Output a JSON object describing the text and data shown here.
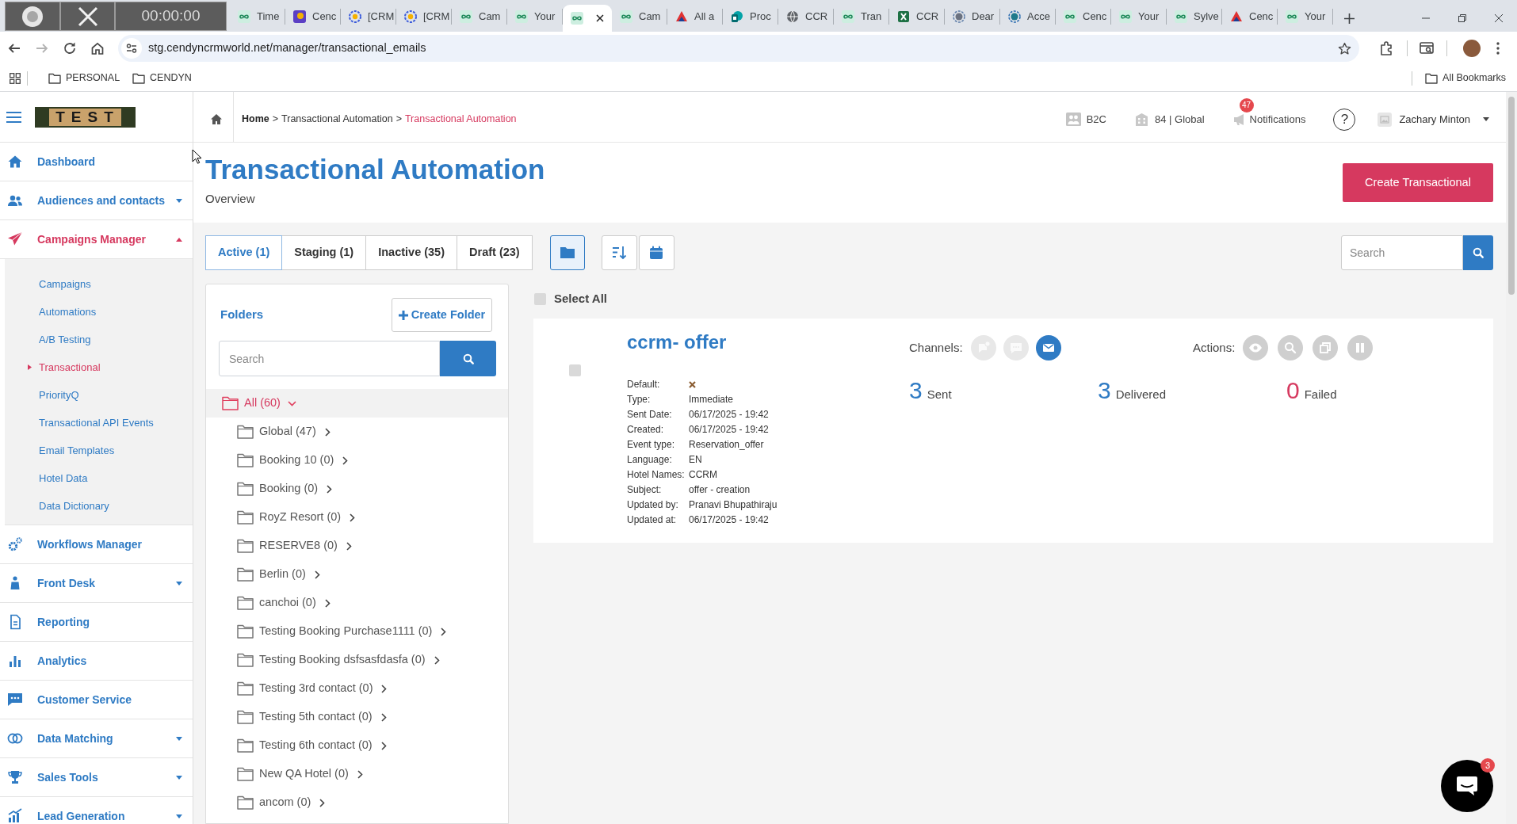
{
  "browser": {
    "recorder": {
      "timer": "00:00:00"
    },
    "tabs": [
      {
        "title": "Time",
        "selected": false
      },
      {
        "title": "Cenc",
        "selected": false
      },
      {
        "title": "[CRM",
        "selected": false
      },
      {
        "title": "[CRM",
        "selected": false
      },
      {
        "title": "Cam",
        "selected": false
      },
      {
        "title": "Your",
        "selected": false
      },
      {
        "selected": true
      },
      {
        "title": "Cam",
        "selected": false
      },
      {
        "title": "All a",
        "selected": false
      },
      {
        "title": "Proc",
        "selected": false
      },
      {
        "title": "CCR",
        "selected": false
      },
      {
        "title": "Tran",
        "selected": false
      },
      {
        "title": "CCR",
        "selected": false
      },
      {
        "title": "Dear",
        "selected": false
      },
      {
        "title": "Acce",
        "selected": false
      },
      {
        "title": "Cenc",
        "selected": false
      },
      {
        "title": "Your",
        "selected": false
      },
      {
        "title": "Sylve",
        "selected": false
      },
      {
        "title": "Cenc",
        "selected": false
      },
      {
        "title": "Your",
        "selected": false
      }
    ],
    "address": "stg.cendyncrmworld.net/manager/transactional_emails",
    "bookmarks": [
      {
        "label": "PERSONAL"
      },
      {
        "label": "CENDYN"
      }
    ],
    "all_bookmarks": {
      "label": "All Bookmarks"
    }
  },
  "sidebar": {
    "logo": "TEST",
    "items": [
      {
        "label": "Dashboard",
        "selected": false
      },
      {
        "label": "Audiences and contacts",
        "selected": false,
        "expanded": false
      },
      {
        "label": "Campaigns Manager",
        "selected": true,
        "expanded": true,
        "children": [
          {
            "label": "Campaigns",
            "selected": false
          },
          {
            "label": "Automations",
            "selected": false
          },
          {
            "label": "A/B Testing",
            "selected": false
          },
          {
            "label": "Transactional",
            "selected": true
          },
          {
            "label": "PriorityQ",
            "selected": false
          },
          {
            "label": "Transactional API Events",
            "selected": false
          },
          {
            "label": "Email Templates",
            "selected": false
          },
          {
            "label": "Hotel Data",
            "selected": false
          },
          {
            "label": "Data Dictionary",
            "selected": false
          }
        ]
      },
      {
        "label": "Workflows Manager",
        "selected": false
      },
      {
        "label": "Front Desk",
        "selected": false,
        "expanded": false
      },
      {
        "label": "Reporting",
        "selected": false
      },
      {
        "label": "Analytics",
        "selected": false
      },
      {
        "label": "Customer Service",
        "selected": false
      },
      {
        "label": "Data Matching",
        "selected": false,
        "expanded": false
      },
      {
        "label": "Sales Tools",
        "selected": false,
        "expanded": false
      },
      {
        "label": "Lead Generation",
        "selected": false,
        "expanded": false
      }
    ]
  },
  "header": {
    "breadcrumb": [
      {
        "label": "Home",
        "current": false
      },
      {
        "label": "Transactional Automation",
        "current": false
      },
      {
        "label": "Transactional Automation",
        "current": true
      }
    ],
    "separators": [
      ">",
      ">"
    ],
    "account": "B2C",
    "property": "84 | Global",
    "notifications": {
      "label": "Notifications",
      "badge": "47"
    },
    "help": "?",
    "user": "Zachary Minton"
  },
  "page": {
    "title": "Transactional Automation",
    "subtitle": "Overview",
    "create_button": "Create Transactional"
  },
  "toolbar": {
    "tabs": [
      {
        "label": "Active (1)",
        "selected": true
      },
      {
        "label": "Staging (1)",
        "selected": false
      },
      {
        "label": "Inactive (35)",
        "selected": false
      },
      {
        "label": "Draft (23)",
        "selected": false
      }
    ],
    "views": [
      {
        "selected": true
      },
      {
        "selected": false
      },
      {
        "selected": false
      }
    ],
    "search": {
      "placeholder": "Search"
    }
  },
  "folders": {
    "title": "Folders",
    "create_button": "Create Folder",
    "search": {
      "placeholder": "Search"
    },
    "tree": [
      {
        "label": "All (60)",
        "selected": true,
        "expanded": true,
        "children": [
          {
            "label": "Global (47)",
            "selected": false,
            "expanded": false
          },
          {
            "label": "Booking 10 (0)",
            "selected": false,
            "expanded": false
          },
          {
            "label": "Booking (0)",
            "selected": false,
            "expanded": false
          },
          {
            "label": "RoyZ Resort (0)",
            "selected": false,
            "expanded": false
          },
          {
            "label": "RESERVE8 (0)",
            "selected": false,
            "expanded": false
          },
          {
            "label": "Berlin (0)",
            "selected": false,
            "expanded": false
          },
          {
            "label": "canchoi (0)",
            "selected": false,
            "expanded": false
          },
          {
            "label": "Testing Booking Purchase1111 (0)",
            "selected": false,
            "expanded": false
          },
          {
            "label": "Testing Booking dsfsasfdasfa (0)",
            "selected": false,
            "expanded": false
          },
          {
            "label": "Testing 3rd contact (0)",
            "selected": false,
            "expanded": false
          },
          {
            "label": "Testing 5th contact (0)",
            "selected": false,
            "expanded": false
          },
          {
            "label": "Testing 6th contact (0)",
            "selected": false,
            "expanded": false
          },
          {
            "label": "New QA Hotel (0)",
            "selected": false,
            "expanded": false
          },
          {
            "label": "ancom (0)",
            "selected": false,
            "expanded": false
          }
        ]
      }
    ]
  },
  "list": {
    "select_all": {
      "label": "Select All",
      "checked": false
    },
    "cards": [
      {
        "checked": false,
        "title": "ccrm- offer",
        "details": [
          {
            "label": "Default:",
            "kind": "flag",
            "on": false
          },
          {
            "label": "Type:",
            "kind": "text",
            "value": "Immediate"
          },
          {
            "label": "Sent Date:",
            "kind": "text",
            "value": "06/17/2025 - 19:42"
          },
          {
            "label": "Created:",
            "kind": "text",
            "value": "06/17/2025 - 19:42"
          },
          {
            "label": "Event type:",
            "kind": "text",
            "value": "Reservation_offer"
          },
          {
            "label": "Language:",
            "kind": "text",
            "value": "EN"
          },
          {
            "label": "Hotel Names:",
            "kind": "text",
            "value": "CCRM"
          },
          {
            "label": "Subject:",
            "kind": "text",
            "value": "offer - creation"
          },
          {
            "label": "Updated by:",
            "kind": "text",
            "value": "Pranavi Bhupathiraju"
          },
          {
            "label": "Updated at:",
            "kind": "text",
            "value": "06/17/2025 - 19:42"
          }
        ],
        "channels_label": "Channels:",
        "channels": [
          {
            "on": false
          },
          {
            "on": false
          },
          {
            "on": true
          }
        ],
        "actions_label": "Actions:",
        "stats": [
          {
            "value": "3",
            "label": "Sent",
            "color": "#2f7bc4"
          },
          {
            "value": "3",
            "label": "Delivered",
            "color": "#2f7bc4"
          },
          {
            "value": "0",
            "label": "Failed",
            "color": "#d6395f"
          }
        ]
      }
    ]
  },
  "chat": {
    "badge": "3"
  }
}
